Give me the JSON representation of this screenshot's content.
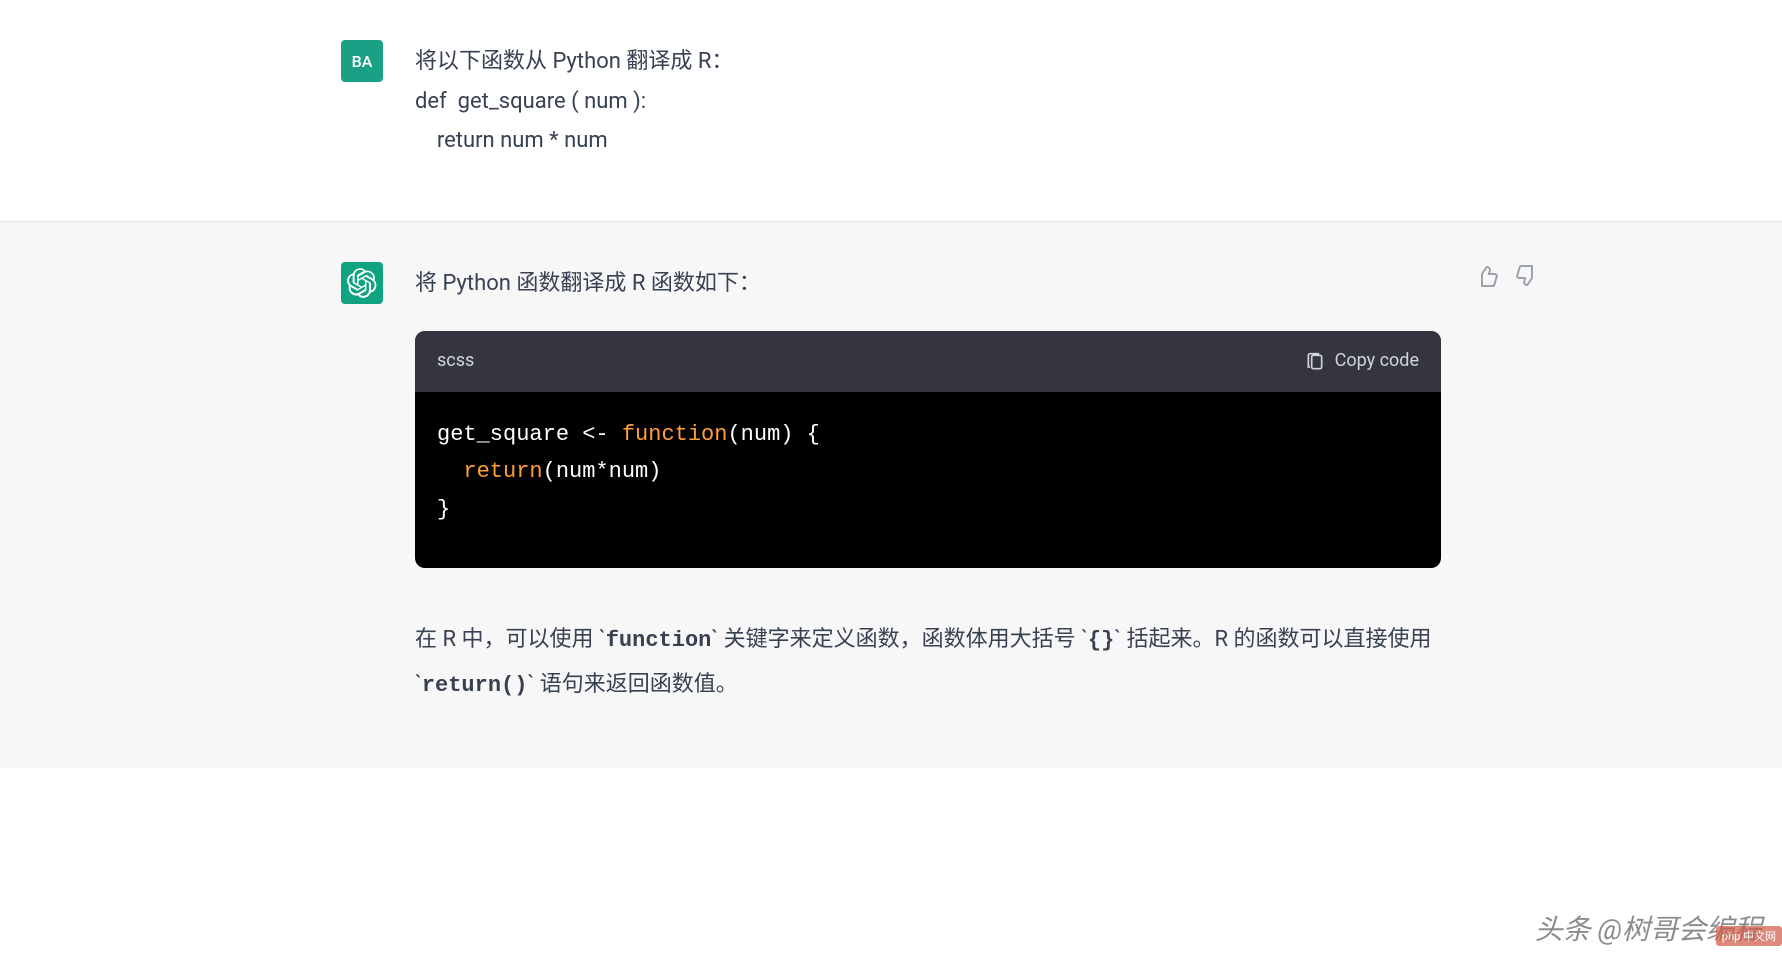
{
  "user": {
    "avatar_text": "BA",
    "message_line1": "将以下函数从 Python 翻译成 R：",
    "message_line2": "def  get_square ( num ):",
    "message_line3": "    return num * num"
  },
  "assistant": {
    "intro": "将 Python 函数翻译成 R 函数如下：",
    "code": {
      "language": "scss",
      "copy_label": "Copy code",
      "line1_name": "get_square",
      "line1_op": " <- ",
      "line1_keyword": "function",
      "line1_after": "(num) {",
      "line2_indent": "  ",
      "line2_keyword": "return",
      "line2_after": "(num*num)",
      "line3": "}"
    },
    "explanation_part1": "在 R 中，可以使用 `",
    "explanation_code1": "function",
    "explanation_part2": "` 关键字来定义函数，函数体用大括号 `",
    "explanation_code2": "{}",
    "explanation_part3": "` 括起来。R 的函数可以直接使用 `",
    "explanation_code3": "return()",
    "explanation_part4": "` 语句来返回函数值。"
  },
  "watermark": {
    "text": "头条 @树哥会编程",
    "badge": "php 中文网"
  }
}
